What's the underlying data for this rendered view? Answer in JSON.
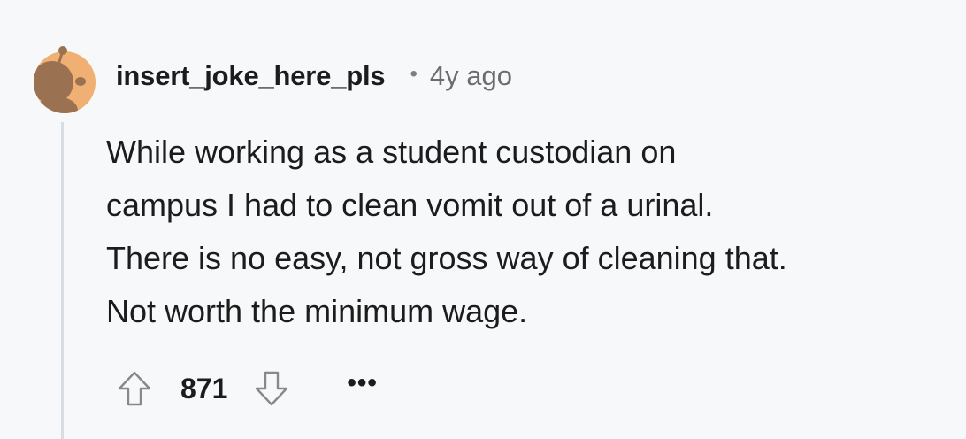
{
  "comment": {
    "author": "insert_joke_here_pls",
    "separator": "•",
    "timestamp": "4y ago",
    "body_lines": [
      "While working as a student custodian on",
      "campus I had to clean vomit out of a urinal.",
      "There is no easy, not gross way of cleaning that.",
      "Not worth the minimum wage."
    ],
    "score": "871",
    "more_label": "•••"
  },
  "icons": {
    "avatar": "snoo-avatar-icon",
    "upvote": "arrow-up-outline-icon",
    "downvote": "arrow-down-outline-icon"
  },
  "colors": {
    "background": "#f7f8fa",
    "thread_line": "#d7dde3",
    "avatar_bg": "#f0b073",
    "avatar_figure": "#9a7252",
    "text": "#1c1c1c",
    "meta_text": "#6a6d70",
    "icon_stroke": "#86898c"
  }
}
